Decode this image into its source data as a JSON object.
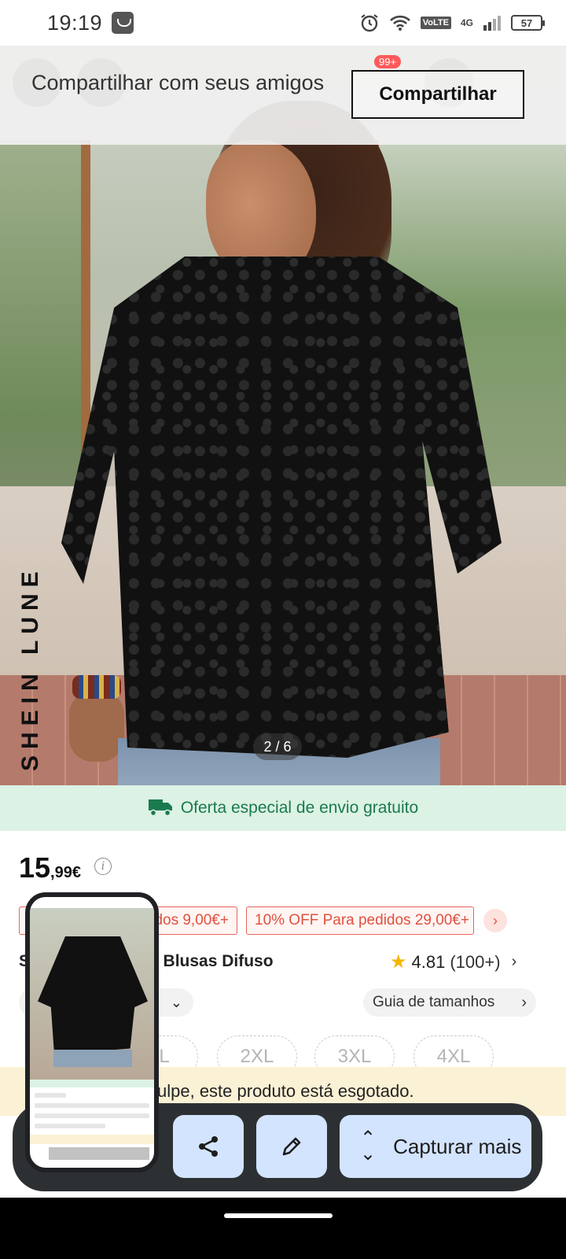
{
  "status_bar": {
    "time": "19:19",
    "network_label": "VoLTE",
    "network_gen": "4G",
    "battery": "57",
    "icons": [
      "app-notification-icon",
      "alarm-icon",
      "wifi-icon",
      "signal-icon",
      "battery-icon"
    ]
  },
  "product": {
    "brand_watermark": "SHEIN LUNE",
    "image_counter": "2 / 6",
    "shipping_offer": "Oferta especial de envio gratuito",
    "price_int": "15",
    "price_dec": ",99€",
    "coupons": [
      "dos 9,00€+",
      "10% OFF Para pedidos 29,00€+"
    ],
    "title_fragment_start": "S",
    "title_fragment_end": "s Blusas Difuso",
    "rating": "4.81",
    "rating_count": "(100+)",
    "size_select_prefix": "T",
    "size_guide": "Guia de tamanhos",
    "sizes": [
      "XL",
      "2XL",
      "3XL",
      "4XL"
    ],
    "sold_out_message": "ulpe, este produto está esgotado."
  },
  "share_banner": {
    "text": "Compartilhar com seus amigos",
    "button": "Compartilhar",
    "badge": "99+"
  },
  "capture_toolbar": {
    "capture_more": "Capturar mais"
  },
  "colors": {
    "shipping_bg": "#dcf2e4",
    "shipping_text": "#1a7a4f",
    "coupon": "#e0513f",
    "toolbar_bg": "#2d3033",
    "toolbar_button": "#d3e4ff",
    "sold_out_bg": "#fbf1d5",
    "star": "#f6b500"
  }
}
